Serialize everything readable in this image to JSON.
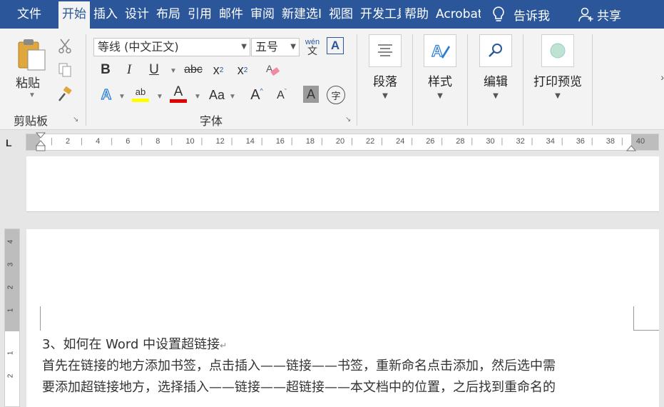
{
  "tabs": {
    "file": "文件",
    "home": "开始",
    "insert": "插入",
    "design": "设计",
    "layout": "布局",
    "references": "引用",
    "mailings": "邮件",
    "review": "审阅",
    "new_tab": "新建选Ι",
    "view": "视图",
    "developer": "开发工具",
    "help": "帮助",
    "acrobat": "Acrobat",
    "tell_me": "告诉我",
    "share": "共享"
  },
  "ribbon": {
    "clipboard": {
      "paste_label": "粘贴",
      "group_label": "剪贴板"
    },
    "font": {
      "font_name": "等线 (中文正文)",
      "font_size": "五号",
      "phonetic_top": "wén",
      "phonetic_bottom": "文",
      "bold": "B",
      "italic": "I",
      "underline": "U",
      "strikethrough": "abc",
      "subscript": "x",
      "subscript_small": "2",
      "superscript": "x",
      "superscript_small": "2",
      "text_effects": "A",
      "highlight": "ab",
      "font_color": "A",
      "change_case": "Aa",
      "grow": "A",
      "shrink": "A",
      "char_shading": "A",
      "enclose": "字",
      "char_border": "A",
      "group_label": "字体"
    },
    "paragraph": {
      "label": "段落"
    },
    "styles": {
      "label": "样式"
    },
    "editing": {
      "label": "编辑"
    },
    "print_preview": {
      "label": "打印预览"
    }
  },
  "ruler": {
    "ticks": [
      "2",
      "4",
      "6",
      "8",
      "10",
      "12",
      "14",
      "16",
      "18",
      "20",
      "22",
      "24",
      "26",
      "28",
      "30",
      "32",
      "34",
      "36",
      "38",
      "40"
    ]
  },
  "vertical_ruler": {
    "numbers": [
      "4",
      "3",
      "2",
      "1",
      "1",
      "2"
    ]
  },
  "document": {
    "line1": "3、如何在 Word 中设置超链接",
    "line2": "首先在链接的地方添加书签，点击插入——链接——书签，重新命名点击添加，然后选中需",
    "line3": "要添加超链接地方，选择插入——链接——超链接——本文档中的位置，之后找到重命名的",
    "para_mark": "↵"
  },
  "colors": {
    "tabbar": "#2b579a",
    "ribbon": "#f3f3f3",
    "highlight_yellow": "#ffff00",
    "font_red": "#e00000"
  }
}
